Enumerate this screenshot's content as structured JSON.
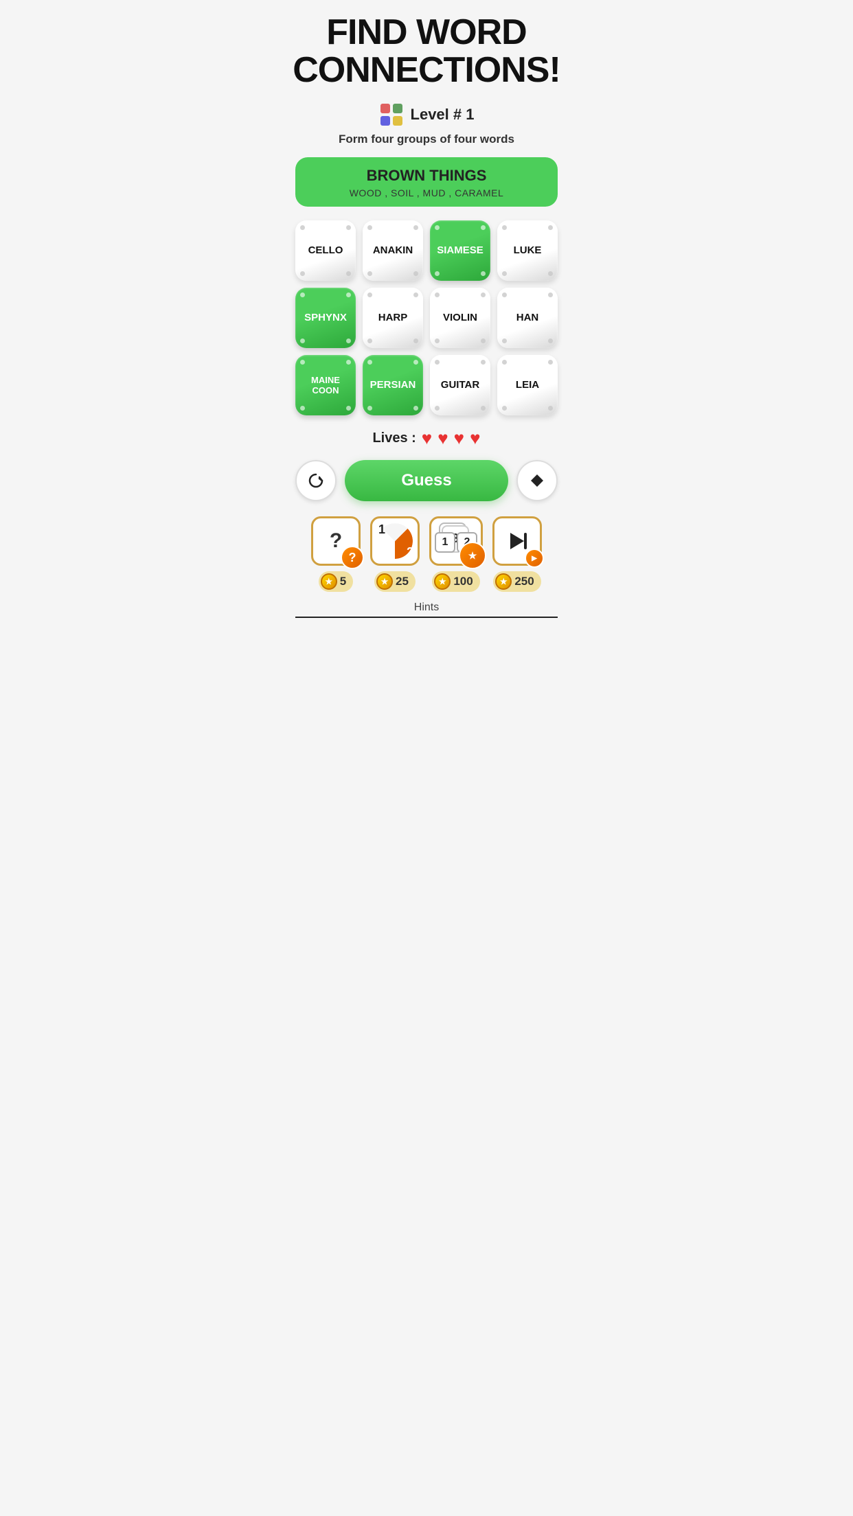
{
  "header": {
    "title": "FIND WORD\nCONNECTIONS!"
  },
  "level": {
    "icon_label": "grid-icon",
    "text": "Level # 1"
  },
  "subtitle": "Form four groups of four words",
  "solved_banner": {
    "title": "BROWN THINGS",
    "words": "WOOD , SOIL , MUD , CARAMEL"
  },
  "tiles": [
    {
      "label": "CELLO",
      "selected": false
    },
    {
      "label": "ANAKIN",
      "selected": false
    },
    {
      "label": "SIAMESE",
      "selected": true
    },
    {
      "label": "LUKE",
      "selected": false
    },
    {
      "label": "SPHYNX",
      "selected": true
    },
    {
      "label": "HARP",
      "selected": false
    },
    {
      "label": "VIOLIN",
      "selected": false
    },
    {
      "label": "HAN",
      "selected": false
    },
    {
      "label": "MAINE\nCOON",
      "selected": true
    },
    {
      "label": "PERSIAN",
      "selected": true
    },
    {
      "label": "GUITAR",
      "selected": false
    },
    {
      "label": "LEIA",
      "selected": false
    }
  ],
  "lives": {
    "label": "Lives :",
    "count": 4
  },
  "buttons": {
    "shuffle": "↺",
    "guess": "Guess",
    "erase": "◆"
  },
  "hints": [
    {
      "type": "question",
      "circle_text": "?",
      "cost": "5"
    },
    {
      "type": "swap",
      "nums": "1 2",
      "cost": "25"
    },
    {
      "type": "reveal",
      "nums": "1 2 3 4",
      "cost": "100"
    },
    {
      "type": "skip",
      "cost": "250"
    }
  ],
  "hints_label": "Hints"
}
